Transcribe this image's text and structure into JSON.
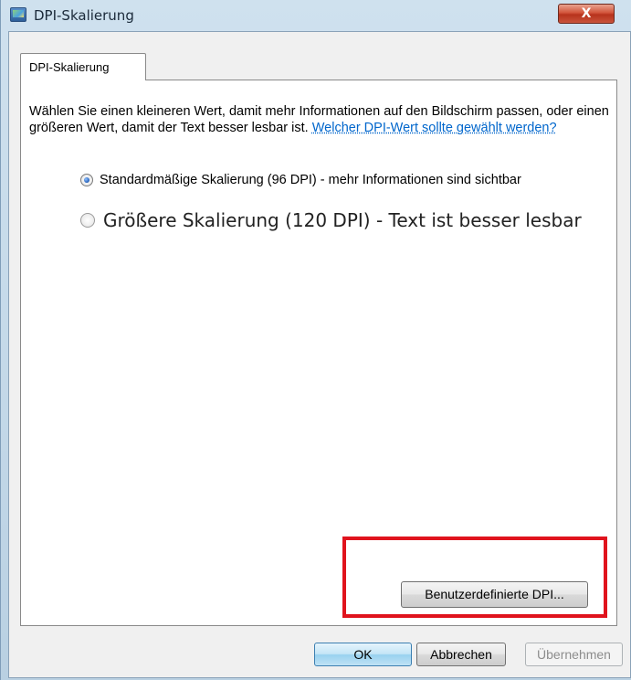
{
  "window": {
    "title": "DPI-Skalierung",
    "close_glyph": "X",
    "icon": "display-settings-icon"
  },
  "tab": {
    "label": "DPI-Skalierung"
  },
  "content": {
    "intro_text": "Wählen Sie einen kleineren Wert, damit mehr Informationen auf den Bildschirm passen, oder einen größeren Wert, damit der Text besser lesbar ist.",
    "help_link": "Welcher DPI-Wert sollte gewählt werden?"
  },
  "options": [
    {
      "label": "Standardmäßige Skalierung (96 DPI) - mehr Informationen sind sichtbar",
      "checked": true
    },
    {
      "label": "Größere Skalierung (120 DPI) - Text ist besser lesbar",
      "checked": false
    }
  ],
  "buttons": {
    "custom_dpi": "Benutzerdefinierte DPI...",
    "ok": "OK",
    "cancel": "Abbrechen",
    "apply": "Übernehmen"
  },
  "colors": {
    "highlight": "#e0131d",
    "link": "#0066cc"
  }
}
